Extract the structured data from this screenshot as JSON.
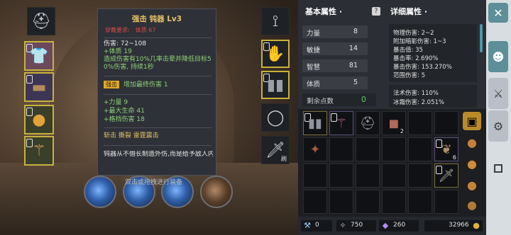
{
  "tooltip": {
    "title": "强击 钝器 Lv3",
    "requirement_label": "穿戴要求:",
    "requirement_value": "体质 67",
    "damage": "伤害: 72~108",
    "constitution": "+体质 19",
    "effect_line1": "造成伤害有10%几率击晕并降低目标5",
    "effect_line2": "0%伤害, 持续1秒",
    "tag": "强击",
    "tag_effect": "增加最终伤害 1",
    "bonus1": "+力量 9",
    "bonus2": "+最大生命 41",
    "bonus3": "+格挡伤害 18",
    "affixes": "斩击   撕裂   雷霆震击",
    "flavor": "钝器从不僭长制造外伤,而是给予敌人内伤。"
  },
  "skill_hint": "双击或拖拽进行装备",
  "stats": {
    "basic_header": "基本属性 ·",
    "detail_header": "详细属性 ·",
    "rows": [
      {
        "label": "力量",
        "value": "8"
      },
      {
        "label": "敏捷",
        "value": "14"
      },
      {
        "label": "智慧",
        "value": "81"
      },
      {
        "label": "体质",
        "value": "5"
      }
    ],
    "remaining_label": "剩余点数",
    "remaining_value": "0",
    "details": [
      "物理伤害: 2~2",
      "附加暗影伤害: 1~3",
      "暴击值: 35",
      "暴击率: 2.690%",
      "暴击伤害: 153.270%",
      "范围伤害: 5"
    ],
    "details2": [
      "法术伤害: 110%",
      "冰霜伤害: 2.051%"
    ]
  },
  "inventory": {
    "counts": {
      "c4": "2",
      "c12": "6"
    }
  },
  "currency": {
    "a": "0",
    "b": "750",
    "c": "260",
    "gold": "32966"
  },
  "right_slot_label": "刷",
  "colors": {
    "accent": "#5c8f97",
    "equip_border": "#c8b23c",
    "title": "#e7c36a"
  }
}
